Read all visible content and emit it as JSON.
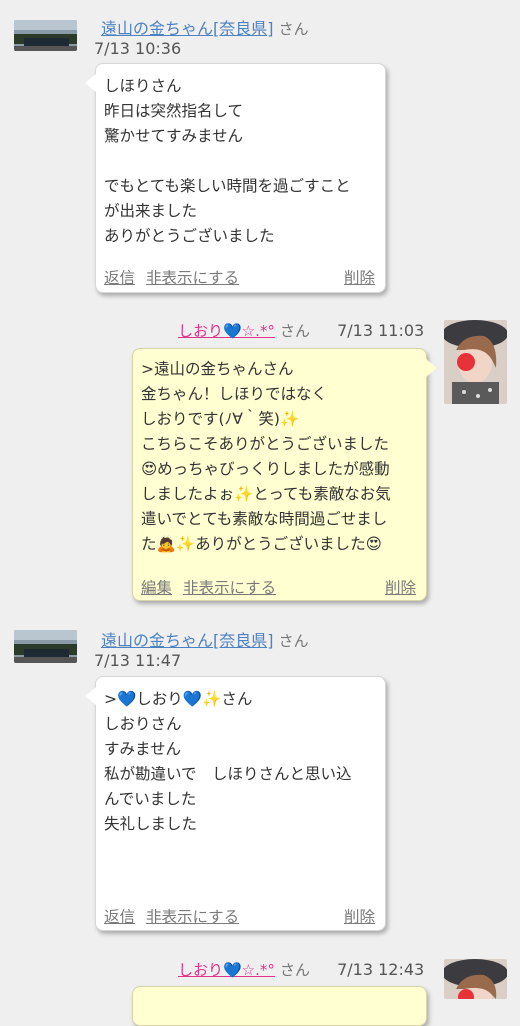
{
  "messages": [
    {
      "user": "遠山の金ちゃん[奈良県]",
      "suffix": "さん",
      "time": "7/13 10:36",
      "lines": [
        "しほりさん",
        "昨日は突然指名して",
        "驚かせてすみません",
        "",
        "でもとても楽しい時間を過ごすこと",
        "が出来ました",
        "ありがとうございました"
      ],
      "actions": [
        "返信",
        "非表示にする",
        "削除"
      ]
    },
    {
      "user": "しおり💙☆.*°",
      "suffix": "さん",
      "time": "7/13 11:03",
      "lines": [
        ">遠山の金ちゃんさん",
        "金ちゃん！しほりではなく",
        "しおりです(ﾉ∀｀笑)✨",
        "こちらこそありがとうございました",
        "😍めっちゃびっくりしましたが感動",
        "しましたよぉ✨とっても素敵なお気",
        "遣いでとても素敵な時間過ごせまし",
        "た🙇✨ありがとうございました😍"
      ],
      "actions": [
        "編集",
        "非表示にする",
        "削除"
      ]
    },
    {
      "user": "遠山の金ちゃん[奈良県]",
      "suffix": "さん",
      "time": "7/13 11:47",
      "lines": [
        ">💙しおり💙✨さん",
        "しおりさん",
        "すみません",
        "私が勘違いで　しほりさんと思い込",
        "んでいました",
        "失礼しました"
      ],
      "actions": [
        "返信",
        "非表示にする",
        "削除"
      ]
    },
    {
      "user": "しおり💙☆.*°",
      "suffix": "さん",
      "time": "7/13 12:43"
    }
  ]
}
